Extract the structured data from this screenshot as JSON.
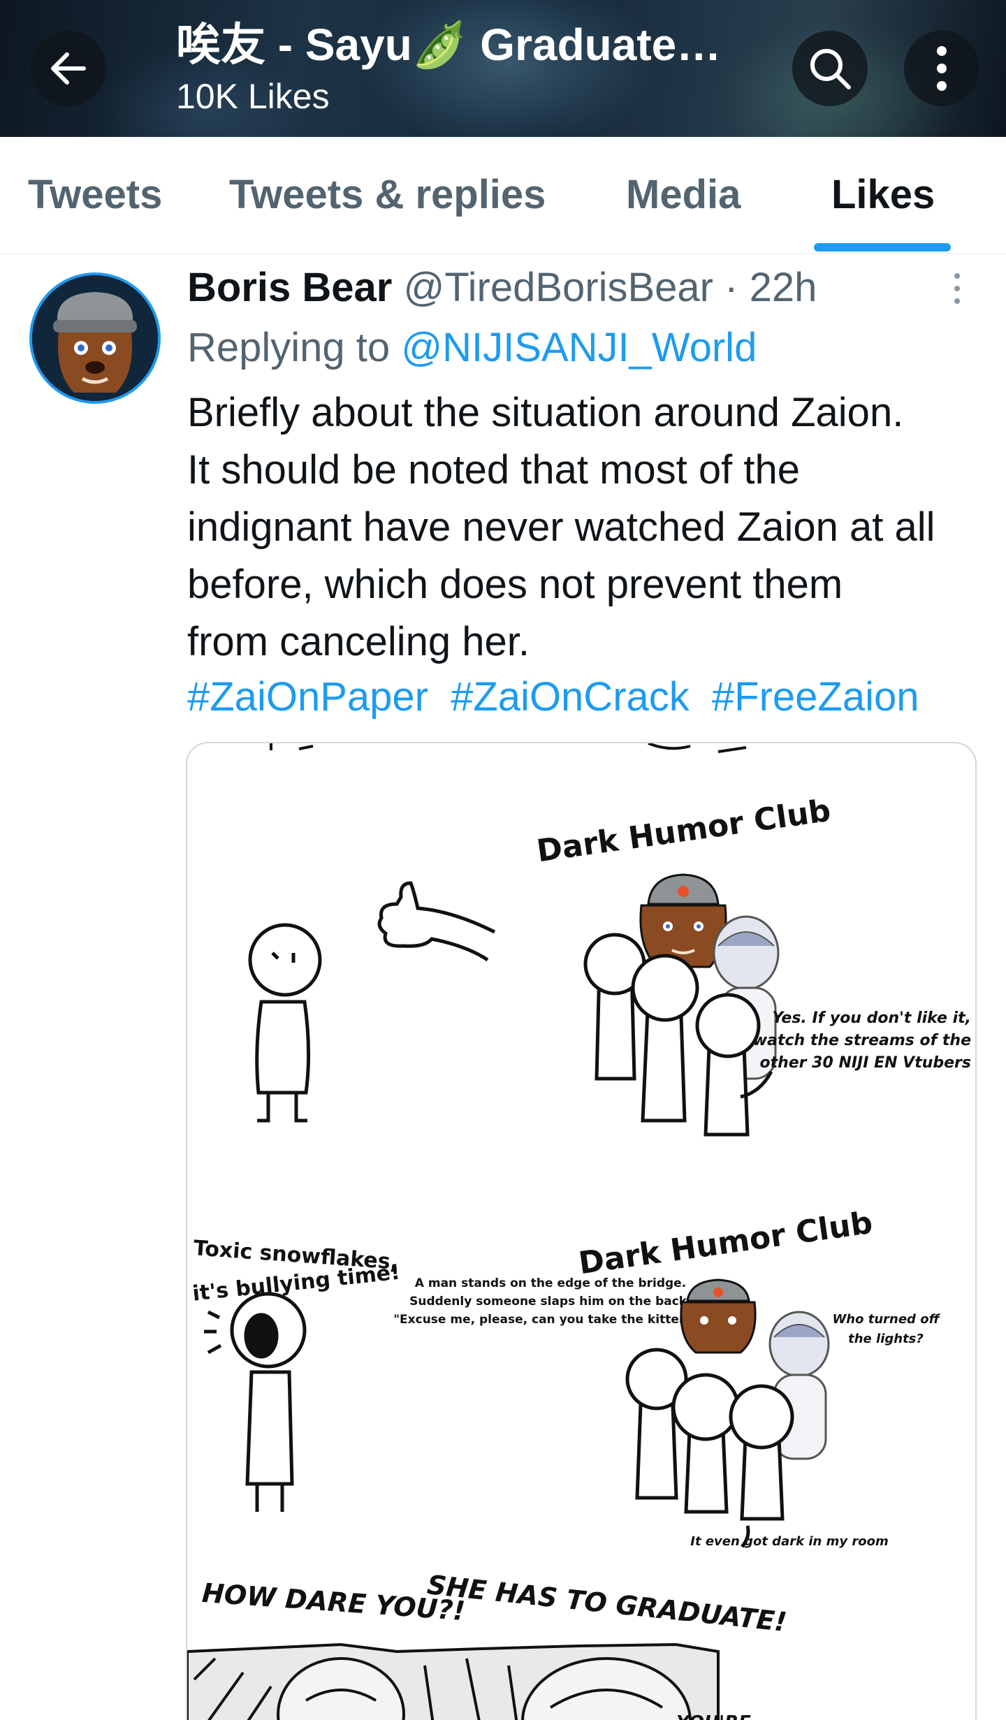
{
  "header": {
    "back_icon": "arrow-left-icon",
    "title": "唉友 - Sayu🫛 Graduate…",
    "subtitle": "10K Likes",
    "search_icon": "search-icon",
    "more_icon": "more-vertical-icon"
  },
  "tabs": [
    {
      "label": "Tweets",
      "active": false
    },
    {
      "label": "Tweets & replies",
      "active": false
    },
    {
      "label": "Media",
      "active": false
    },
    {
      "label": "Likes",
      "active": true
    }
  ],
  "tweet": {
    "author_name": "Boris Bear",
    "handle": "@TiredBorisBear",
    "separator": "·",
    "time": "22h",
    "replying_to_prefix": "Replying to",
    "replying_to": "@NIJISANJI_World",
    "body_lines": [
      "Briefly about the situation around Zaion.",
      "It should be noted that most of the",
      "indignant have never watched Zaion at all",
      "before, which does not prevent them",
      "from canceling her."
    ],
    "hashtags": [
      "#ZaiOnPaper",
      "#ZaiOnCrack",
      "#FreeZaion"
    ],
    "media": {
      "panel1_title": "Dark Humor Club",
      "panel1_caption_lines": [
        "Yes. If you don't like it,",
        "watch the streams of the",
        "other 30 NIJI EN Vtubers"
      ],
      "panel2_left_lines": [
        "Toxic snowflakes,",
        "it's bullying time!"
      ],
      "panel2_title": "Dark Humor Club",
      "panel2_joke_lines": [
        "A man stands on the edge of the bridge.",
        "Suddenly someone slaps him on the back:",
        "\"Excuse me, please, can you take the kittens?\""
      ],
      "panel2_reply_lines": [
        "Who turned off",
        "the lights?"
      ],
      "panel2_bottom": "It even got dark in my room",
      "panel3_left": "HOW DARE YOU?!",
      "panel3_right": "SHE HAS TO GRADUATE!",
      "panel3_partial": "YOU'RE"
    }
  },
  "colors": {
    "accent": "#1d9bf0",
    "text_primary": "#0f1419",
    "text_secondary": "#536471",
    "divider": "#eff3f4"
  }
}
